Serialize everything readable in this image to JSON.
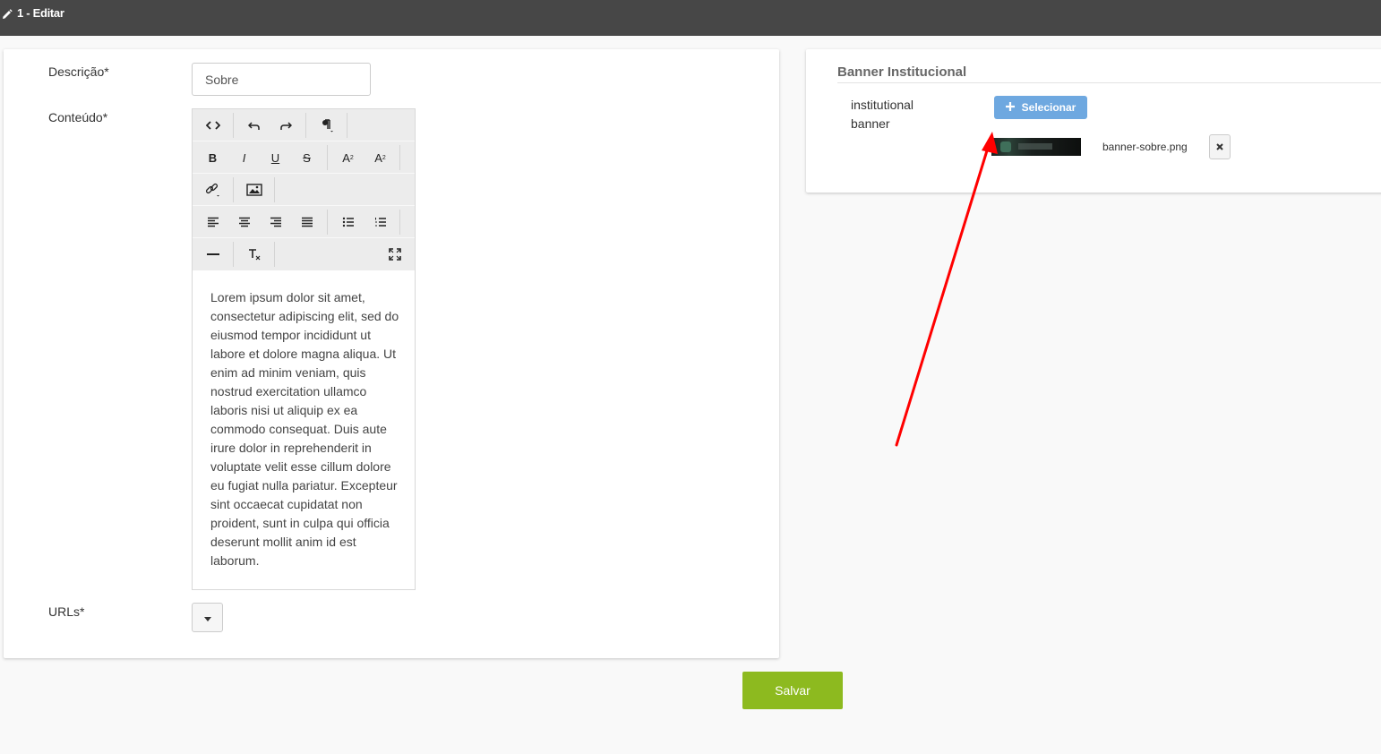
{
  "header": {
    "title": "1 - Editar"
  },
  "form": {
    "descricao_label": "Descrição*",
    "descricao_value": "Sobre",
    "conteudo_label": "Conteúdo*",
    "conteudo_text": "Lorem ipsum dolor sit amet, consectetur adipiscing elit, sed do eiusmod tempor incididunt ut labore et dolore magna aliqua. Ut enim ad minim veniam, quis nostrud exercitation ullamco laboris nisi ut aliquip ex ea commodo consequat. Duis aute irure dolor in reprehenderit in voluptate velit esse cillum dolore eu fugiat nulla pariatur. Excepteur sint occaecat cupidatat non proident, sunt in culpa qui officia deserunt mollit anim id est laborum.",
    "urls_label": "URLs*"
  },
  "editor_toolbar": {
    "rows": [
      [
        "code-view",
        "undo",
        "redo",
        "paragraph-format"
      ],
      [
        "bold",
        "italic",
        "underline",
        "strikethrough",
        "superscript",
        "subscript"
      ],
      [
        "insert-link",
        "insert-image"
      ],
      [
        "align-left",
        "align-center",
        "align-right",
        "align-justify",
        "unordered-list",
        "ordered-list"
      ],
      [
        "horizontal-line",
        "clear-formatting",
        "fullscreen"
      ]
    ]
  },
  "banner": {
    "section_title": "Banner Institucional",
    "field_label": "institutional banner",
    "select_label": "Selecionar",
    "file_name": "banner-sobre.png"
  },
  "actions": {
    "save_label": "Salvar"
  },
  "annotation": {
    "arrow_color": "#ff0000"
  },
  "colors": {
    "topbar": "#474747",
    "select_button": "#6ea8e0",
    "save_button": "#8dba1f"
  }
}
